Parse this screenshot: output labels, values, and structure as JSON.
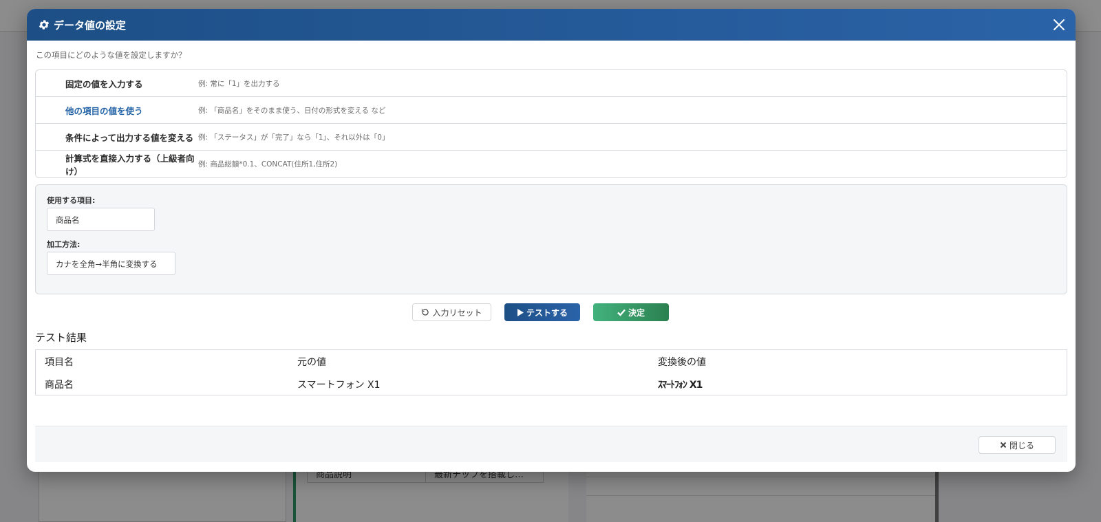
{
  "modal": {
    "title": "データ値の設定",
    "question": "この項目にどのような値を設定しますか？"
  },
  "options": [
    {
      "label": "固定の値を入力する",
      "example": "例: 常に「1」を出力する"
    },
    {
      "label": "他の項目の値を使う",
      "example": "例: 「商品名」をそのまま使う、日付の形式を変える など"
    },
    {
      "label": "条件によって出力する値を変える",
      "example": "例: 「ステータス」が「完了」なら「1」、それ以外は「0」"
    },
    {
      "label": "計算式を直接入力する（上級者向け）",
      "example": "例: 商品総額*0.1、CONCAT(住所1,住所2)"
    }
  ],
  "config": {
    "source_label": "使用する項目:",
    "source_value": "商品名",
    "method_label": "加工方法:",
    "method_value": "カナを全角→半角に変換する"
  },
  "buttons": {
    "reset": "入力リセット",
    "test": "テストする",
    "confirm": "決定",
    "close": "閉じる"
  },
  "results": {
    "title": "テスト結果",
    "headers": [
      "項目名",
      "元の値",
      "変換後の値"
    ],
    "rows": [
      [
        "商品名",
        "スマートフォン X1",
        "ｽﾏｰﾄﾌｫﾝ X1"
      ]
    ]
  },
  "background": {
    "table_cells": [
      "商品説明",
      "最新チップを搭載し…"
    ]
  },
  "colors": {
    "header": "#2463a6",
    "active_option": "#2463a6",
    "confirm": "#3a9c6b"
  }
}
